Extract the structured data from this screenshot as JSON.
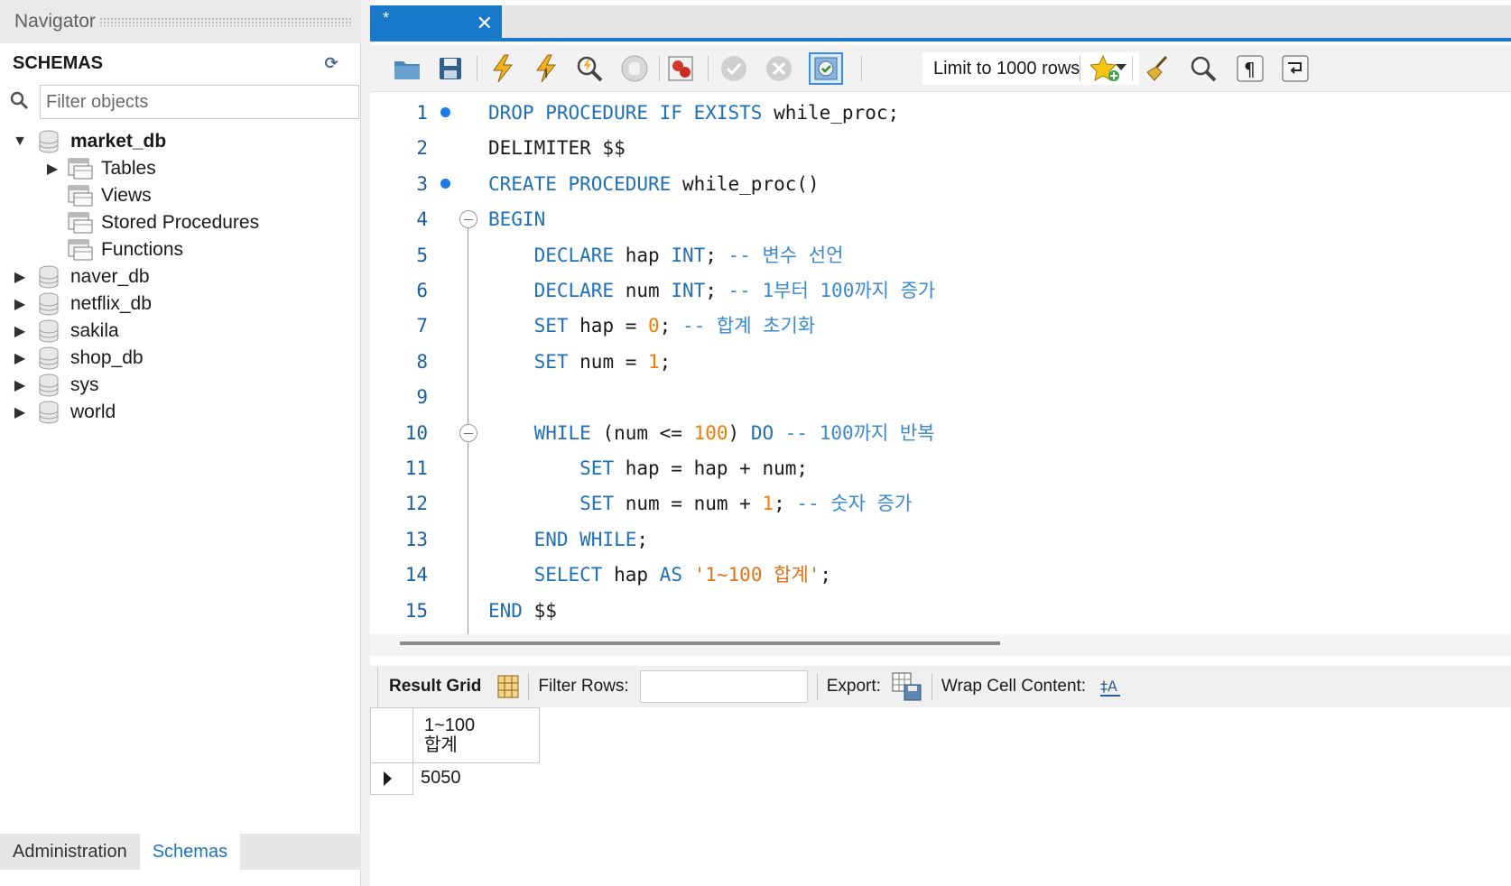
{
  "navigator": {
    "title": "Navigator",
    "schemas_header": "SCHEMAS",
    "filter_placeholder": "Filter objects",
    "tree": [
      {
        "label": "market_db",
        "expanded": true,
        "bold": true
      },
      {
        "label": "Tables",
        "child": true,
        "has_arrow": true
      },
      {
        "label": "Views",
        "child": true
      },
      {
        "label": "Stored Procedures",
        "child": true
      },
      {
        "label": "Functions",
        "child": true
      },
      {
        "label": "naver_db"
      },
      {
        "label": "netflix_db"
      },
      {
        "label": "sakila"
      },
      {
        "label": "shop_db"
      },
      {
        "label": "sys"
      },
      {
        "label": "world"
      }
    ],
    "tabs": [
      {
        "label": "Administration",
        "active": false
      },
      {
        "label": "Schemas",
        "active": true
      }
    ]
  },
  "editor": {
    "tab_label": "*",
    "limit_label": "Limit to 1000 rows",
    "lines": [
      {
        "n": "1",
        "bp": true,
        "tokens": [
          [
            "kw",
            "DROP PROCEDURE IF EXISTS "
          ],
          [
            "",
            "while_proc;"
          ]
        ]
      },
      {
        "n": "2",
        "tokens": [
          [
            "",
            "DELIMITER $$"
          ]
        ]
      },
      {
        "n": "3",
        "bp": true,
        "tokens": [
          [
            "kw",
            "CREATE PROCEDURE "
          ],
          [
            "",
            "while_proc()"
          ]
        ]
      },
      {
        "n": "4",
        "fold": true,
        "tokens": [
          [
            "kw",
            "BEGIN"
          ]
        ]
      },
      {
        "n": "5",
        "tokens": [
          [
            "",
            "    "
          ],
          [
            "kw",
            "DECLARE "
          ],
          [
            "",
            "hap "
          ],
          [
            "kw",
            "INT"
          ],
          [
            "",
            "; "
          ],
          [
            "cm",
            "-- 변수 선언"
          ]
        ]
      },
      {
        "n": "6",
        "tokens": [
          [
            "",
            "    "
          ],
          [
            "kw",
            "DECLARE "
          ],
          [
            "",
            "num "
          ],
          [
            "kw",
            "INT"
          ],
          [
            "",
            "; "
          ],
          [
            "cm",
            "-- 1부터 100까지 증가"
          ]
        ]
      },
      {
        "n": "7",
        "tokens": [
          [
            "",
            "    "
          ],
          [
            "kw",
            "SET "
          ],
          [
            "",
            "hap = "
          ],
          [
            "num",
            "0"
          ],
          [
            "",
            "; "
          ],
          [
            "cm",
            "-- 합계 초기화"
          ]
        ]
      },
      {
        "n": "8",
        "tokens": [
          [
            "",
            "    "
          ],
          [
            "kw",
            "SET "
          ],
          [
            "",
            "num = "
          ],
          [
            "num",
            "1"
          ],
          [
            "",
            ";"
          ]
        ]
      },
      {
        "n": "9",
        "tokens": []
      },
      {
        "n": "10",
        "fold": true,
        "tokens": [
          [
            "",
            "    "
          ],
          [
            "kw",
            "WHILE "
          ],
          [
            "",
            "(num <= "
          ],
          [
            "num",
            "100"
          ],
          [
            "",
            ") "
          ],
          [
            "kw",
            "DO "
          ],
          [
            "cm",
            "-- 100까지 반복"
          ]
        ]
      },
      {
        "n": "11",
        "tokens": [
          [
            "",
            "        "
          ],
          [
            "kw",
            "SET "
          ],
          [
            "",
            "hap = hap + num;"
          ]
        ]
      },
      {
        "n": "12",
        "tokens": [
          [
            "",
            "        "
          ],
          [
            "kw",
            "SET "
          ],
          [
            "",
            "num = num + "
          ],
          [
            "num",
            "1"
          ],
          [
            "",
            "; "
          ],
          [
            "cm",
            "-- 숫자 증가"
          ]
        ]
      },
      {
        "n": "13",
        "tokens": [
          [
            "",
            "    "
          ],
          [
            "kw",
            "END WHILE"
          ],
          [
            "",
            ";"
          ]
        ]
      },
      {
        "n": "14",
        "tokens": [
          [
            "",
            "    "
          ],
          [
            "kw",
            "SELECT "
          ],
          [
            "",
            "hap "
          ],
          [
            "kw",
            "AS "
          ],
          [
            "str",
            "'1~100 합계'"
          ],
          [
            "",
            ";"
          ]
        ]
      },
      {
        "n": "15",
        "tokens": [
          [
            "kw",
            "END "
          ],
          [
            "",
            "$$"
          ]
        ]
      }
    ]
  },
  "results": {
    "tab_label": "Result Grid",
    "filter_label": "Filter Rows:",
    "export_label": "Export:",
    "wrap_label": "Wrap Cell Content:",
    "column_header_line1": "1~100",
    "column_header_line2": "합계",
    "rows": [
      [
        "5050"
      ]
    ]
  },
  "colors": {
    "accent": "#1a78c8",
    "keyword": "#1f6fb6",
    "number": "#f07c00",
    "comment": "#3a89cf"
  }
}
